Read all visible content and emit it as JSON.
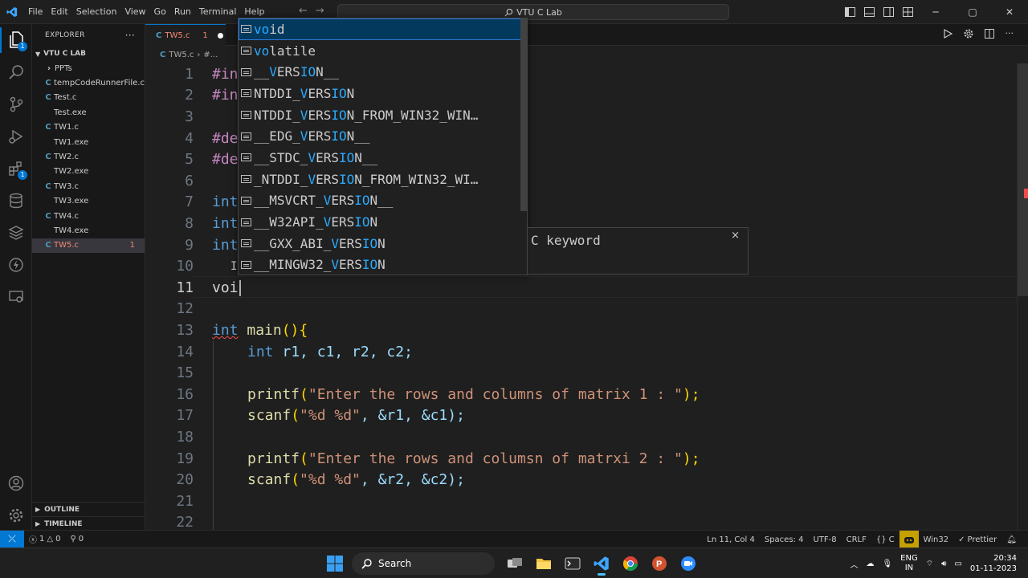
{
  "titlebar": {
    "menu": [
      "File",
      "Edit",
      "Selection",
      "View",
      "Go",
      "Run",
      "Terminal",
      "Help"
    ],
    "command_center": "VTU C Lab"
  },
  "explorer": {
    "header": "EXPLORER",
    "folder": "VTU C LAB",
    "items": [
      {
        "label": "PPTs",
        "type": "folder"
      },
      {
        "label": "tempCodeRunnerFile.c",
        "type": "c"
      },
      {
        "label": "Test.c",
        "type": "c"
      },
      {
        "label": "Test.exe",
        "type": "exe"
      },
      {
        "label": "TW1.c",
        "type": "c"
      },
      {
        "label": "TW1.exe",
        "type": "exe"
      },
      {
        "label": "TW2.c",
        "type": "c"
      },
      {
        "label": "TW2.exe",
        "type": "exe"
      },
      {
        "label": "TW3.c",
        "type": "c"
      },
      {
        "label": "TW3.exe",
        "type": "exe"
      },
      {
        "label": "TW4.c",
        "type": "c"
      },
      {
        "label": "TW4.exe",
        "type": "exe"
      },
      {
        "label": "TW5.c",
        "type": "c",
        "selected": true,
        "badge": "1"
      }
    ],
    "outline": "OUTLINE",
    "timeline": "TIMELINE"
  },
  "tab": {
    "label": "TW5.c",
    "problems": "1"
  },
  "breadcrumb": {
    "file": "TW5.c",
    "rest": "#..."
  },
  "editor": {
    "line_numbers": [
      "1",
      "2",
      "3",
      "4",
      "5",
      "6",
      "7",
      "8",
      "9",
      "10",
      "11",
      "12",
      "13",
      "14",
      "15",
      "16",
      "17",
      "18",
      "19",
      "20",
      "21",
      "22"
    ],
    "visible": {
      "l1": "#in",
      "l2": "#in",
      "l4": "#de",
      "l5": "#de",
      "l7": "int",
      "l8": "int",
      "l9": "int",
      "l11": "voi",
      "l13_kw": "int",
      "l13_fn": "main",
      "l13_rest": "(){",
      "l14_kw": "int",
      "l14_rest": " r1, c1, r2, c2;",
      "l16_fn": "printf",
      "l16_str": "\"Enter the rows and columns of matrix 1 : \"",
      "l16_end": ");",
      "l17_fn": "scanf",
      "l17_str": "\"%d %d\"",
      "l17_end": ", &r1, &c1);",
      "l19_fn": "printf",
      "l19_str": "\"Enter the rows and columsn of matrxi 2 : \"",
      "l19_end": ");",
      "l20_fn": "scanf",
      "l20_str": "\"%d %d\"",
      "l20_end": ", &r2, &c2);"
    }
  },
  "suggest": {
    "items": [
      {
        "pre": "",
        "hl": "vo",
        "mid": "i",
        "hl2": "",
        "post": "d",
        "selected": true
      },
      {
        "pre": "",
        "hl": "vo",
        "mid": "latile",
        "hl2": "",
        "post": ""
      },
      {
        "pre": "__",
        "hl": "V",
        "mid": "ERS",
        "hl2": "IO",
        "post": "N__"
      },
      {
        "pre": "NTDDI_",
        "hl": "V",
        "mid": "ERS",
        "hl2": "IO",
        "post": "N"
      },
      {
        "pre": "NTDDI_",
        "hl": "V",
        "mid": "ERS",
        "hl2": "IO",
        "post": "N_FROM_WIN32_WIN…"
      },
      {
        "pre": "__EDG_",
        "hl": "V",
        "mid": "ERS",
        "hl2": "IO",
        "post": "N__"
      },
      {
        "pre": "__STDC_",
        "hl": "V",
        "mid": "ERS",
        "hl2": "IO",
        "post": "N__"
      },
      {
        "pre": "_NTDDI_",
        "hl": "V",
        "mid": "ERS",
        "hl2": "IO",
        "post": "N_FROM_WIN32_WI…"
      },
      {
        "pre": "__MSVCRT_",
        "hl": "V",
        "mid": "ERS",
        "hl2": "IO",
        "post": "N__"
      },
      {
        "pre": "__W32API_",
        "hl": "V",
        "mid": "ERS",
        "hl2": "IO",
        "post": "N"
      },
      {
        "pre": "__GXX_ABI_",
        "hl": "V",
        "mid": "ERS",
        "hl2": "IO",
        "post": "N"
      },
      {
        "pre": "__MINGW32_",
        "hl": "V",
        "mid": "ERS",
        "hl2": "IO",
        "post": "N"
      }
    ],
    "details": "C keyword",
    "close": "×"
  },
  "statusbar": {
    "errors": "1",
    "warnings": "0",
    "ports": "0",
    "position": "Ln 11, Col 4",
    "spaces": "Spaces: 4",
    "encoding": "UTF-8",
    "eol": "CRLF",
    "language": "C",
    "config": "Win32",
    "prettier": "Prettier"
  },
  "taskbar": {
    "search": "Search",
    "lang_top": "ENG",
    "lang_bottom": "IN",
    "time": "20:34",
    "date": "01-11-2023"
  },
  "colors": {
    "accent": "#0078d4",
    "highlight": "#2aaaff",
    "error": "#f48771"
  }
}
